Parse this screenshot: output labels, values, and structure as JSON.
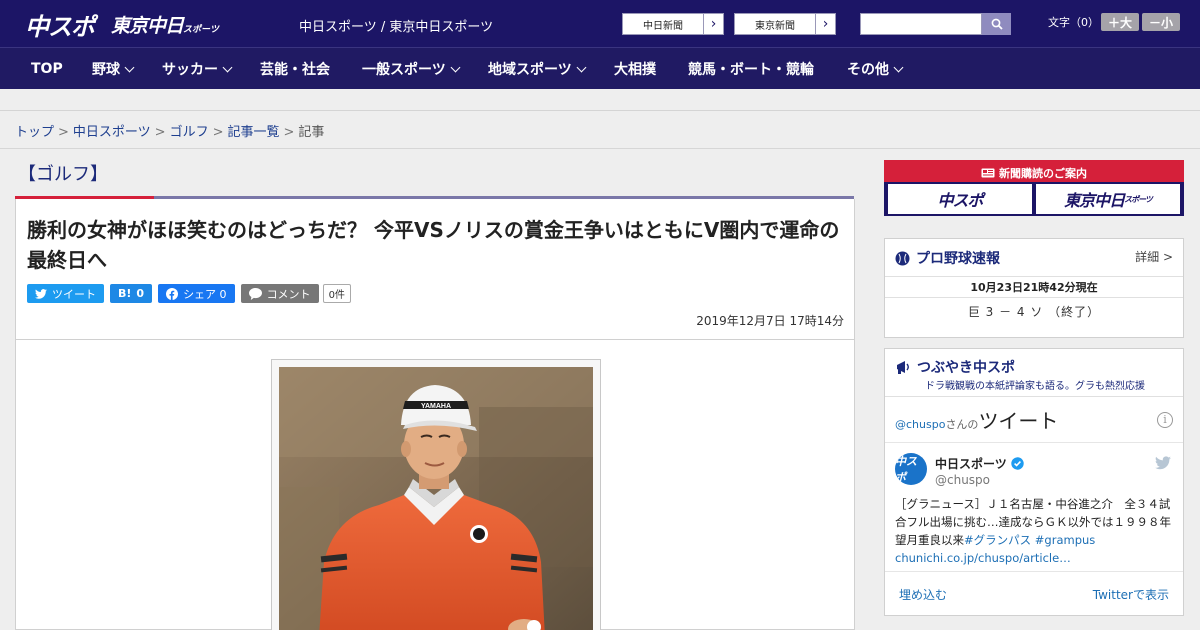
{
  "header": {
    "logo_chuspo": "中スポ",
    "logo_tokyo": "東京中日",
    "logo_tokyo_small": "スポーツ",
    "site_name": "中日スポーツ / 東京中日スポーツ",
    "links": [
      "中日新聞",
      "東京新聞"
    ],
    "font_size_label": "文字（0）",
    "font_larger": "＋大",
    "font_smaller": "－小"
  },
  "nav": {
    "items": [
      "TOP",
      "野球",
      "サッカー",
      "芸能・社会",
      "一般スポーツ",
      "地域スポーツ",
      "大相撲",
      "競馬・ボート・競輪",
      "その他"
    ]
  },
  "breadcrumb": {
    "items": [
      "トップ",
      "中日スポーツ",
      "ゴルフ",
      "記事一覧"
    ],
    "current": "記事"
  },
  "article": {
    "category": "【ゴルフ】",
    "headline": "勝利の女神がほほ笑むのはどっちだ？ 今平VSノリスの賞金王争いはともにV圏内で運命の最終日へ",
    "share": {
      "tweet": "ツイート",
      "hatena_label": "B!",
      "hatena_count": "0",
      "facebook": "シェア 0",
      "comment": "コメント",
      "comment_count": "0件"
    },
    "date": "2019年12月7日 17時14分",
    "cap_text": "YAMAHA"
  },
  "sidebar": {
    "subscribe": {
      "heading": "新聞購読のご案内",
      "logo1": "中スポ",
      "logo2": "東京中日",
      "logo2_small": "スポーツ"
    },
    "baseball": {
      "title": "プロ野球速報",
      "detail": "詳細 >",
      "date": "10月23日21時42分現在",
      "score": "巨 3 － 4 ソ （終了）"
    },
    "tsubuyaki": {
      "title": "つぶやき中スポ",
      "subtitle": "ドラ戦観戦の本紙評論家も語る。グラも熱烈応援",
      "header_user": "@chuspo",
      "header_san": "さんの",
      "header_tweet": "ツイート",
      "tweet_name": "中日スポーツ",
      "tweet_handle": "@chuspo",
      "avatar_text": "中スポ",
      "tweet_text": "［グラニュース］Ｊ１名古屋・中谷進之介　全３４試合フル出場に挑む…達成ならＧＫ以外では１９９８年望月重良以来",
      "tweet_tags": "#グランパス #grampus",
      "tweet_link": "chunichi.co.jp/chuspo/article…",
      "embed": "埋め込む",
      "view_on_twitter": "Twitterで表示"
    }
  },
  "colors": {
    "header_bg": "#1c1566",
    "accent_red": "#d5203a",
    "link_blue": "#1e3f8f",
    "twitter": "#1d9bf0",
    "hatena": "#1e88e5",
    "facebook": "#1877f2",
    "comment": "#777777"
  }
}
